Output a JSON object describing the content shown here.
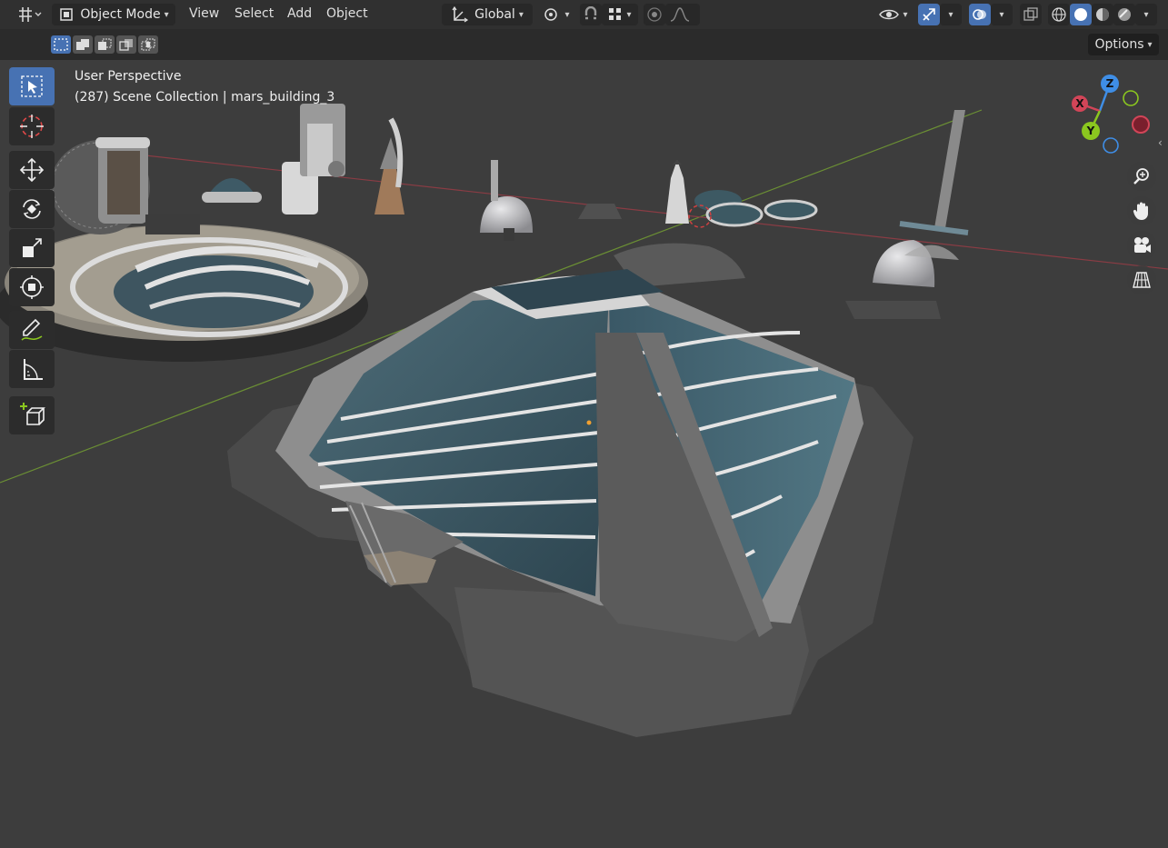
{
  "header": {
    "editor_type_icon": "grid-editor-icon",
    "mode_label": "Object Mode",
    "menu": [
      "View",
      "Select",
      "Add",
      "Object"
    ],
    "orientation_label": "Global",
    "icons": {
      "orientation": "transform-orientation-icon",
      "pivot": "pivot-link-icon",
      "snap": "magnet-icon",
      "snap_target": "snap-grid-icon",
      "proportional": "proportional-edit-icon",
      "falloff": "falloff-curve-icon",
      "visibility": "eye-icon",
      "gizmo": "gizmo-toggle-icon",
      "overlays": "overlays-icon",
      "xray": "xray-icon",
      "shading_wire": "wireframe-shading-icon",
      "shading_solid": "solid-shading-icon",
      "shading_material": "material-shading-icon",
      "shading_rendered": "rendered-shading-icon"
    }
  },
  "subbar": {
    "options_label": "Options",
    "select_modes": [
      "select-new-icon",
      "select-extend-icon",
      "select-subtract-icon",
      "select-difference-icon",
      "select-intersect-icon"
    ]
  },
  "viewport": {
    "view_name": "User Perspective",
    "collection_line": "(287) Scene Collection | mars_building_3"
  },
  "toolbar": {
    "tools": [
      "select-box-icon",
      "cursor-icon",
      "move-icon",
      "rotate-icon",
      "scale-icon",
      "transform-icon",
      "annotate-icon",
      "measure-icon",
      "add-cube-icon"
    ]
  },
  "navigation": {
    "gizmo_axes": {
      "x": "X",
      "y": "Y",
      "z": "Z"
    },
    "buttons": [
      "zoom-icon",
      "pan-hand-icon",
      "camera-icon",
      "ortho-grid-icon"
    ]
  },
  "colors": {
    "accent": "#4772b3",
    "axis_x": "#d24558",
    "axis_y": "#8bc71f",
    "axis_z": "#3f8ee6",
    "viewport_bg": "#3d3d3d"
  }
}
